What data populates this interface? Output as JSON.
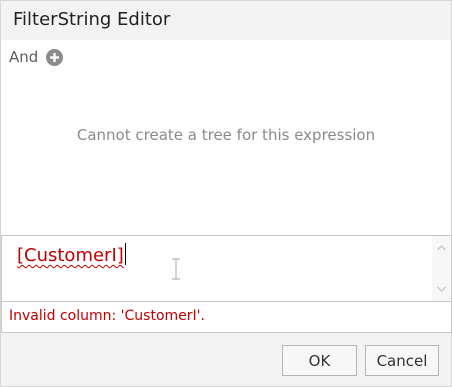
{
  "dialog": {
    "title": "FilterString Editor"
  },
  "tree": {
    "group_operator": "And",
    "add_icon": "plus-circle-icon",
    "message": "Cannot create a tree for this expression"
  },
  "editor": {
    "value": "[CustomerI]",
    "cursor_icon": "ibeam-cursor-icon"
  },
  "error": {
    "message": "Invalid column: 'CustomerI'."
  },
  "buttons": {
    "ok_label": "OK",
    "cancel_label": "Cancel"
  },
  "colors": {
    "error_red": "#c00000",
    "add_icon_gray": "#8c8c8c",
    "message_gray": "#8a8a8a"
  }
}
